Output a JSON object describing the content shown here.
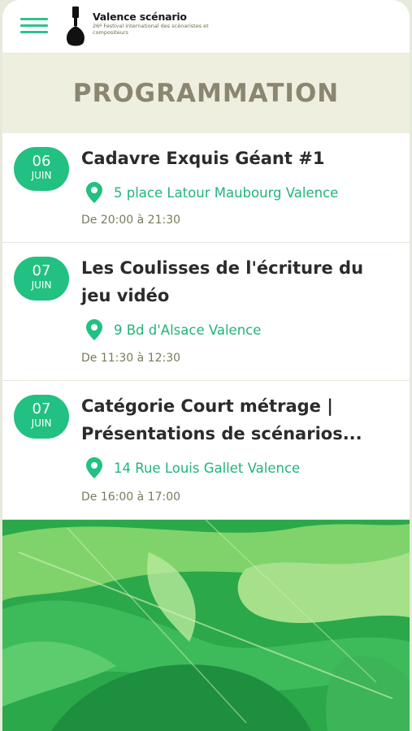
{
  "header": {
    "menu_icon": "hamburger-icon",
    "logo_title": "Valence scénario",
    "logo_subtitle": "26º Festival international des scénaristes et compositeurs"
  },
  "section": {
    "title": "PROGRAMMATION"
  },
  "events": [
    {
      "day": "06",
      "month": "JUIN",
      "title": "Cadavre Exquis Géant #1",
      "location": "5 place Latour Maubourg Valence",
      "time": "De 20:00 à 21:30"
    },
    {
      "day": "07",
      "month": "JUIN",
      "title": "Les Coulisses de l'écriture du jeu vidéo",
      "location": "9 Bd d'Alsace Valence",
      "time": "De 11:30 à 12:30"
    },
    {
      "day": "07",
      "month": "JUIN",
      "title": "Catégorie Court métrage | Présentations de scénarios...",
      "location": "14 Rue Louis Gallet Valence",
      "time": "De 16:00 à 17:00"
    }
  ],
  "colors": {
    "accent": "#22c081",
    "location_text": "#22b47a",
    "section_bg": "#efefe0",
    "section_title": "#8a8670"
  },
  "footer_image": "green-leaves-background"
}
